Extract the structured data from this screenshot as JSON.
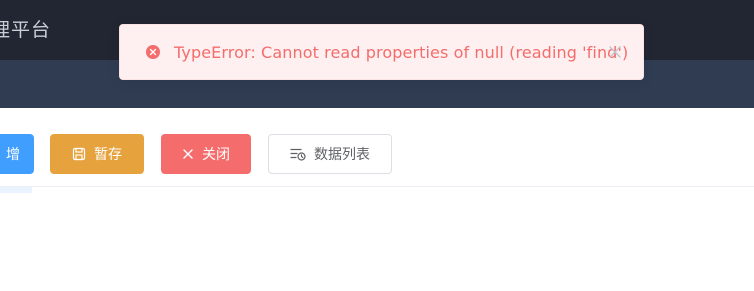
{
  "header": {
    "title": "理平台"
  },
  "toolbar": {
    "add_label": "增",
    "save_label": "暂存",
    "close_label": "关闭",
    "list_label": "数据列表"
  },
  "message": {
    "type": "error",
    "text": "TypeError: Cannot read properties of null (reading 'find')",
    "icon": "error-circle-icon",
    "close_icon": "close-icon"
  },
  "colors": {
    "header_bg": "#222633",
    "subbar_bg": "#2f3c52",
    "primary": "#409eff",
    "warning": "#e6a23c",
    "danger": "#f56c6c",
    "error_bg": "#fef0f0"
  },
  "icons": {
    "save": "save-icon",
    "close": "x-icon",
    "list": "list-clock-icon"
  }
}
